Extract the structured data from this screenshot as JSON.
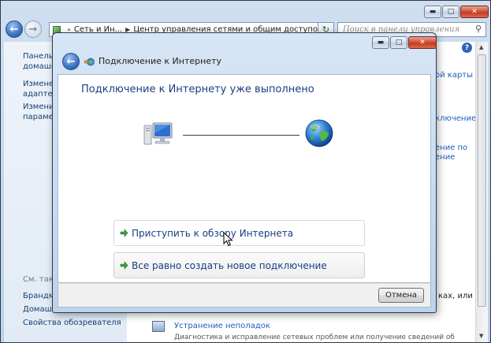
{
  "background_window": {
    "address_crumbs": [
      "Сеть и Ин...",
      "Центр управления сетями и общим доступом"
    ],
    "search_placeholder": "Поиск в панели управления",
    "sidebar": {
      "links": [
        {
          "lines": [
            "Панель у",
            "домашня"
          ]
        },
        {
          "lines": [
            "Изменен",
            "адаптера"
          ]
        },
        {
          "lines": [
            "Изменит",
            "параметр"
          ]
        }
      ],
      "see_also_header": "См. такж",
      "see_also_links": [
        "Брандма",
        "Домашн",
        "Свойства обозревателя"
      ]
    },
    "right_fragments": [
      "ой карты",
      "ключение",
      "ение по",
      "ение",
      "ках, или"
    ],
    "troubleshoot_title": "Устранение неполадок",
    "troubleshoot_desc": "Диагностика и исправление сетевых проблем или получение сведений об",
    "help_glyph": "?"
  },
  "dialog": {
    "title": "Подключение к Интернету",
    "heading": "Подключение к Интернету уже выполнено",
    "options": [
      {
        "label": "Приступить к обзору Интернета"
      },
      {
        "label": "Все равно создать новое подключение"
      }
    ],
    "cancel_label": "Отмена"
  },
  "icons": {
    "back": "back-arrow-icon",
    "forward": "forward-arrow-icon",
    "computer": "computer-icon",
    "globe": "globe-icon",
    "option_arrow": "green-arrow-icon",
    "search": "search-icon",
    "cursor": "mouse-cursor-icon"
  },
  "colors": {
    "link": "#1a3e82",
    "frame": "#bcd2ea",
    "close_button": "#c33b22"
  }
}
